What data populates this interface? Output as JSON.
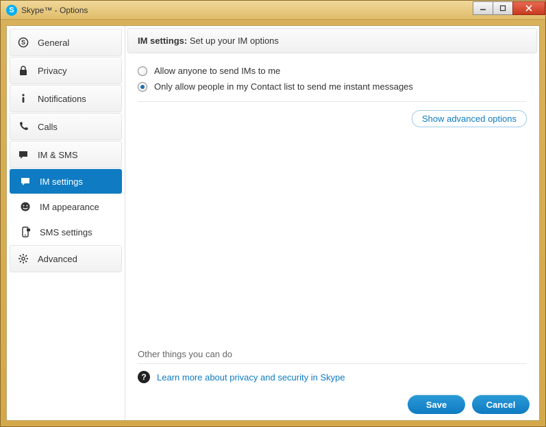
{
  "window": {
    "title": "Skype™ - Options"
  },
  "sidebar": {
    "items": [
      {
        "icon": "skype",
        "label": "General"
      },
      {
        "icon": "lock",
        "label": "Privacy"
      },
      {
        "icon": "info",
        "label": "Notifications"
      },
      {
        "icon": "phone",
        "label": "Calls"
      },
      {
        "icon": "chat",
        "label": "IM & SMS"
      },
      {
        "icon": "chat",
        "label": "IM settings",
        "sub": true,
        "selected": true
      },
      {
        "icon": "smile",
        "label": "IM appearance",
        "sub": true
      },
      {
        "icon": "sms",
        "label": "SMS settings",
        "sub": true
      },
      {
        "icon": "gear",
        "label": "Advanced"
      }
    ]
  },
  "main": {
    "heading_bold": "IM settings:",
    "heading_rest": " Set up your IM options",
    "radios": [
      {
        "label": "Allow anyone to send IMs to me",
        "checked": false
      },
      {
        "label": "Only allow people in my Contact list to send me instant messages",
        "checked": true
      }
    ],
    "advanced_link": "Show advanced options",
    "other_title": "Other things you can do",
    "learn_link": "Learn more about privacy and security in Skype"
  },
  "footer": {
    "save": "Save",
    "cancel": "Cancel"
  }
}
